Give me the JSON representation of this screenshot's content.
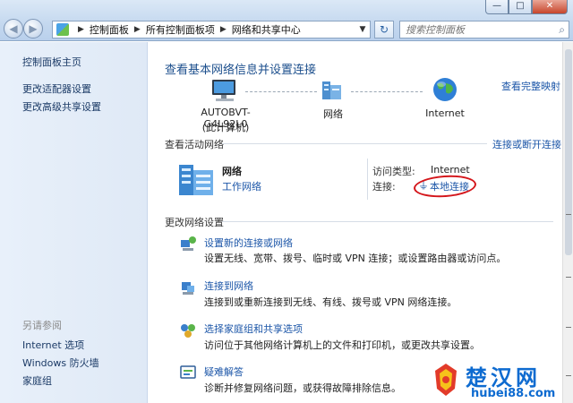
{
  "window": {
    "controls": {
      "minimize": "—",
      "maximize": "□",
      "close": "✕"
    }
  },
  "address_bar": {
    "crumbs": [
      "控制面板",
      "所有控制面板项",
      "网络和共享中心"
    ],
    "search_placeholder": "搜索控制面板"
  },
  "sidebar": {
    "links": [
      "控制面板主页",
      "更改适配器设置",
      "更改高级共享设置"
    ],
    "see_also_heading": "另请参阅",
    "see_also": [
      "Internet 选项",
      "Windows 防火墙",
      "家庭组"
    ]
  },
  "main": {
    "title": "查看基本网络信息并设置连接",
    "full_map_link": "查看完整映射",
    "map": {
      "computer_name": "AUTOBVT-G4L92L0",
      "computer_sub": "(此计算机)",
      "network_label": "网络",
      "internet_label": "Internet"
    },
    "active": {
      "heading": "查看活动网络",
      "connect_link": "连接或断开连接",
      "network_name": "网络",
      "network_type": "工作网络",
      "access_type_label": "访问类型:",
      "access_type_value": "Internet",
      "connection_label": "连接:",
      "connection_value": "本地连接"
    },
    "settings": {
      "heading": "更改网络设置",
      "tasks": [
        {
          "title": "设置新的连接或网络",
          "desc": "设置无线、宽带、拨号、临时或 VPN 连接；或设置路由器或访问点。"
        },
        {
          "title": "连接到网络",
          "desc": "连接到或重新连接到无线、有线、拨号或 VPN 网络连接。"
        },
        {
          "title": "选择家庭组和共享选项",
          "desc": "访问位于其他网络计算机上的文件和打印机，或更改共享设置。"
        },
        {
          "title": "疑难解答",
          "desc": "诊断并修复网络问题，或获得故障排除信息。"
        }
      ]
    }
  },
  "watermark": {
    "title": "楚汉网",
    "url": "hubei88.com"
  },
  "colors": {
    "link": "#1c56a8",
    "title": "#1c4f8d",
    "highlight_circle": "#d4161b",
    "brand": "#0e6bd0"
  }
}
